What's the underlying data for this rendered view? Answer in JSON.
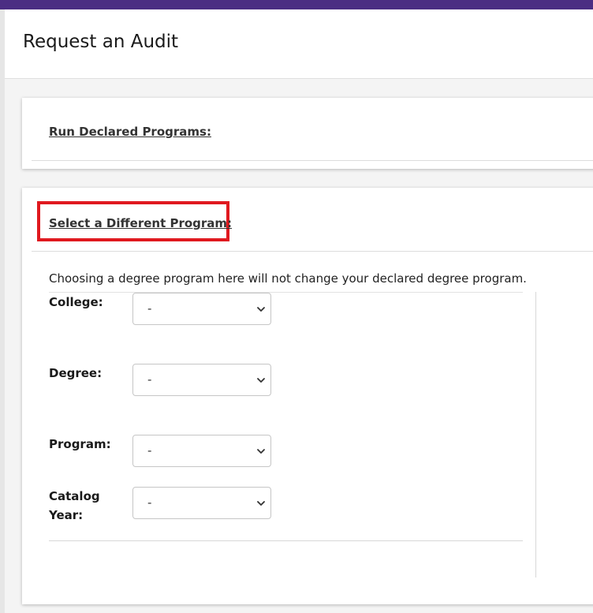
{
  "header": {
    "title": "Request an Audit"
  },
  "sections": {
    "declared": {
      "label": "Run Declared Programs:"
    },
    "different": {
      "label": "Select a Different Program:",
      "note": "Choosing a degree program here will not change your declared degree program."
    }
  },
  "form": {
    "college": {
      "label": "College:",
      "value": "-"
    },
    "degree": {
      "label": "Degree:",
      "value": "-"
    },
    "program": {
      "label": "Program:",
      "value": "-"
    },
    "catalog_year": {
      "label_line1": "Catalog",
      "label_line2": "Year:",
      "value": "-"
    }
  },
  "colors": {
    "brand_bar": "#4b2e83",
    "highlight": "#e0191f"
  },
  "icons": {
    "select_chevron": "chevron-down-icon"
  }
}
